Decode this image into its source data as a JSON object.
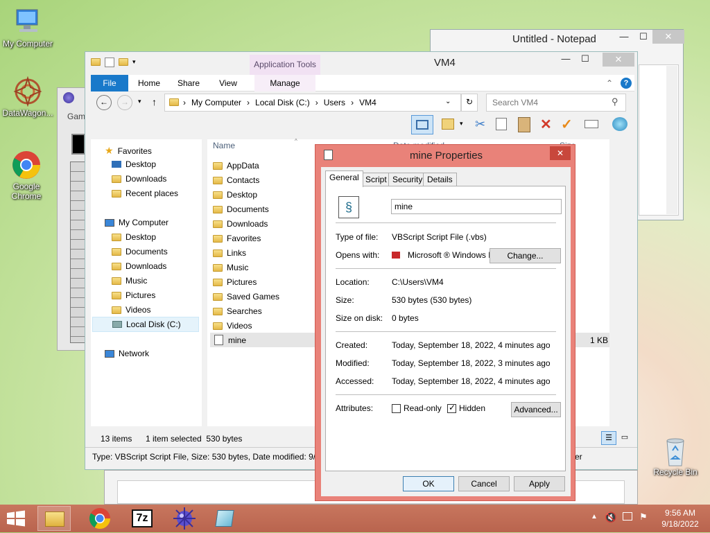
{
  "desktop": {
    "icons": [
      {
        "label": "My Computer"
      },
      {
        "label": "DataWagon..."
      },
      {
        "label": "Google Chrome"
      },
      {
        "label": "Recycle Bin"
      }
    ]
  },
  "notepad": {
    "title": "Untitled - Notepad",
    "minimize": "—",
    "maximize": "☐",
    "close": "✕"
  },
  "game": {
    "tab_label": "Gam"
  },
  "explorer": {
    "title": "VM4",
    "contextual_tab_group": "Application Tools",
    "tabs": [
      "File",
      "Home",
      "Share",
      "View",
      "Manage"
    ],
    "breadcrumb": [
      "My Computer",
      "Local Disk (C:)",
      "Users",
      "VM4"
    ],
    "search_placeholder": "Search VM4",
    "column_name": "Name",
    "column_date_partial": "Date modified",
    "column_size_partial": "Size",
    "nav": {
      "favorites_header": "Favorites",
      "favorites": [
        "Desktop",
        "Downloads",
        "Recent places"
      ],
      "computer_header": "My Computer",
      "computer_items": [
        "Desktop",
        "Documents",
        "Downloads",
        "Music",
        "Pictures",
        "Videos",
        "Local Disk (C:)"
      ],
      "network": "Network"
    },
    "files": [
      "AppData",
      "Contacts",
      "Desktop",
      "Documents",
      "Downloads",
      "Favorites",
      "Links",
      "Music",
      "Pictures",
      "Saved Games",
      "Searches",
      "Videos",
      "mine"
    ],
    "mine_size": "1 KB",
    "status_items": "13 items",
    "status_selected": "1 item selected  530 bytes",
    "details_bar": "Type: VBScript Script File, Size: 530 bytes, Date modified: 9/18/",
    "details_bar_tail": "er"
  },
  "properties": {
    "title": "mine Properties",
    "tabs": [
      "General",
      "Script",
      "Security",
      "Details"
    ],
    "filename": "mine",
    "rows": {
      "type_label": "Type of file:",
      "type_value": "VBScript Script File (.vbs)",
      "opens_label": "Opens with:",
      "opens_value": "Microsoft ® Windows B",
      "change_button": "Change...",
      "location_label": "Location:",
      "location_value": "C:\\Users\\VM4",
      "size_label": "Size:",
      "size_value": "530 bytes (530 bytes)",
      "size_on_disk_label": "Size on disk:",
      "size_on_disk_value": "0 bytes",
      "created_label": "Created:",
      "created_value": "Today, September 18, 2022, 4 minutes ago",
      "modified_label": "Modified:",
      "modified_value": "Today, September 18, 2022, 3 minutes ago",
      "accessed_label": "Accessed:",
      "accessed_value": "Today, September 18, 2022, 4 minutes ago",
      "attributes_label": "Attributes:",
      "readonly_label": "Read-only",
      "readonly_checked": false,
      "hidden_label": "Hidden",
      "hidden_checked": true,
      "advanced_button": "Advanced..."
    },
    "ok": "OK",
    "cancel": "Cancel",
    "apply": "Apply"
  },
  "taskbar": {
    "time": "9:56 AM",
    "date": "9/18/2022",
    "sevenzip_label": "7z"
  },
  "colors": {
    "dialog_border": "#e98279",
    "explorer_accent": "#1979ca",
    "taskbar": "#c06c55"
  }
}
